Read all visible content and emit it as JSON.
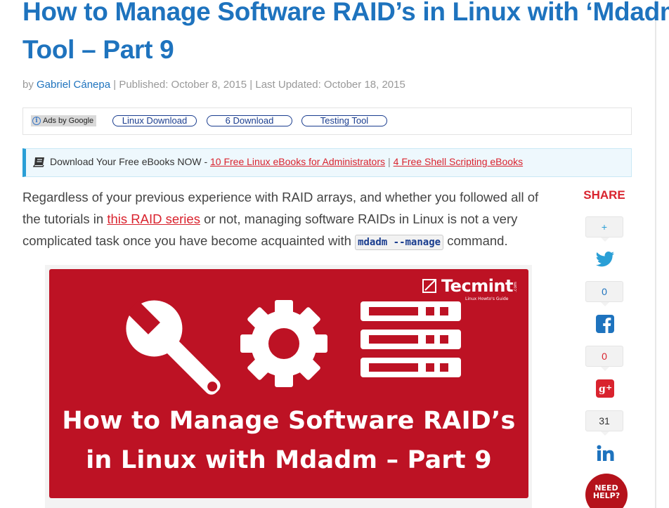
{
  "article": {
    "title_line1": "How to Manage Software RAID’s in Linux with ‘Mdadm’",
    "title_line2": "Tool – Part 9",
    "by": "by",
    "author": "Gabriel Cánepa",
    "published": "| Published: October 8, 2015 | Last Updated: October 18, 2015"
  },
  "ads": {
    "badge": "Ads by Google",
    "links": [
      "Linux Download",
      "6 Download",
      "Testing Tool"
    ]
  },
  "ebooks": {
    "lead": "Download Your Free eBooks NOW -",
    "link1": "10 Free Linux eBooks for Administrators",
    "separator": "|",
    "link2": "4 Free Shell Scripting eBooks"
  },
  "body": {
    "text1": "Regardless of your previous experience with RAID arrays, and whether you followed all of the tutorials in",
    "link": "this RAID series",
    "text2": "or not, managing software RAIDs in Linux is not a very complicated task once you have become acquainted with",
    "code": "mdadm --manage",
    "text3": "command."
  },
  "hero": {
    "brand_name": "Tecmint",
    "brand_tag": "Linux Howto's Guide",
    "brand_com": ".com",
    "headline_line1": "How to Manage Software RAID’s",
    "headline_line2": "in Linux with Mdadm – Part 9",
    "bg_color": "#bd1224"
  },
  "share": {
    "title": "SHARE",
    "twitter_count": "+",
    "facebook_count": "0",
    "googleplus_count": "0",
    "linkedin_count": "31",
    "help_line1": "NEED",
    "help_line2": "HELP?"
  },
  "colors": {
    "link_blue": "#1e73be",
    "accent_red": "#d9232e",
    "twitter": "#2a9fd6",
    "facebook": "#1e73be",
    "googleplus": "#d9232e",
    "linkedin": "#1e73be"
  }
}
